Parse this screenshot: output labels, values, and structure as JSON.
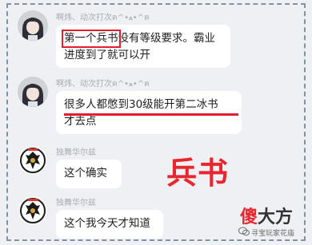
{
  "messages": [
    {
      "sender": "啊炜、动次打次ฅ^•ﻌ•^ฅ",
      "avatar": "anime-character-avatar",
      "line1_boxed": "第一个兵书",
      "line1_rest": "没有等级要求。霸业",
      "line2": "进度到了就可以开"
    },
    {
      "sender": "啊炜、动次打次ฅ^•ﻌ•^ฅ",
      "avatar": "anime-character-avatar",
      "line1_underlined": "很多人都憋到30级能开第二冰书",
      "line2": "才去点"
    },
    {
      "sender": "独舞华尔兹",
      "avatar": "crest-avatar",
      "text": "这个确实"
    },
    {
      "sender": "独舞华尔兹",
      "avatar": "crest-avatar",
      "text": "这个我今天才知道"
    }
  ],
  "overlay": {
    "label": "兵书",
    "color": "#e8262e"
  },
  "watermark": {
    "brand_first": "傻",
    "brand_rest": "大方",
    "caption": "寻宝玩家花庙"
  },
  "colors": {
    "background": "#eef0f3",
    "bubble": "#ffffff",
    "highlight": "#e31d2d",
    "frame": "#7f93a7"
  }
}
